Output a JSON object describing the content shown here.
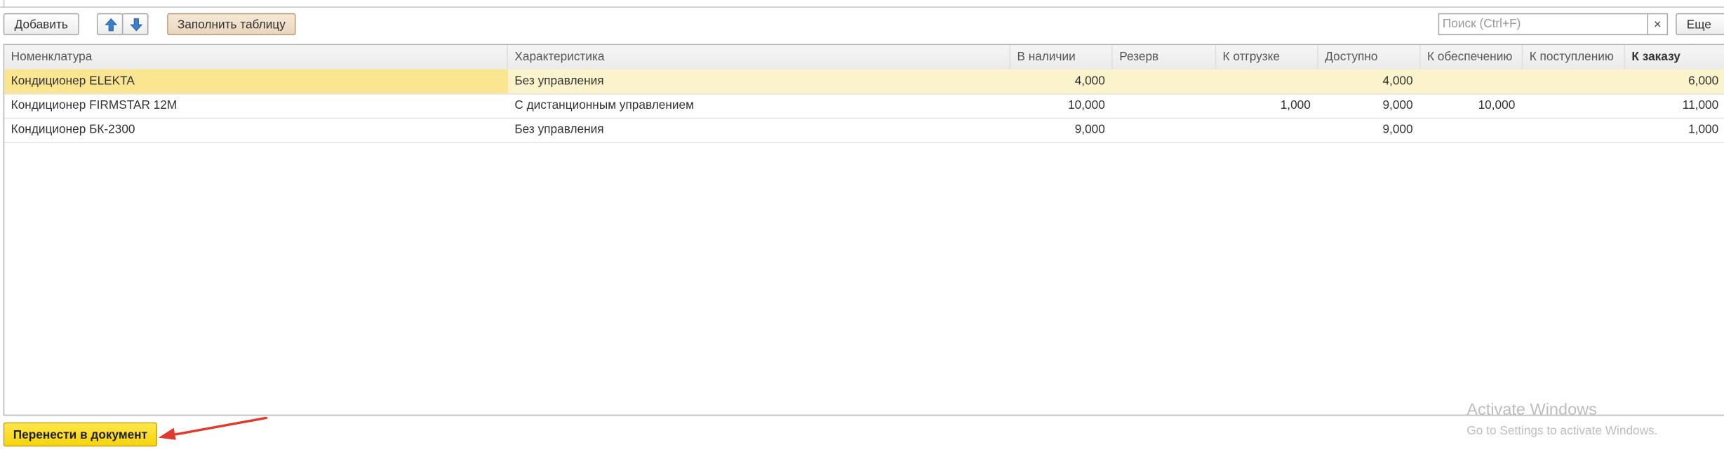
{
  "toolbar": {
    "add_label": "Добавить",
    "fill_label": "Заполнить таблицу",
    "more_label": "Еще",
    "up_icon": "arrow-up-icon",
    "down_icon": "arrow-down-icon"
  },
  "search": {
    "placeholder": "Поиск (Ctrl+F)",
    "value": "",
    "clear_label": "×"
  },
  "table": {
    "columns": [
      "Номенклатура",
      "Характеристика",
      "В наличии",
      "Резерв",
      "К отгрузке",
      "Доступно",
      "К обеспечению",
      "К поступлению",
      "К заказу"
    ],
    "rows": [
      {
        "item": "Кондиционер ELEKTA",
        "characteristic": "Без управления",
        "in_stock": "4,000",
        "reserve": "",
        "to_ship": "",
        "available": "4,000",
        "to_provide": "",
        "to_receive": "",
        "to_order": "6,000",
        "selected": true
      },
      {
        "item": "Кондиционер FIRMSTAR 12M",
        "characteristic": "С дистанционным управлением",
        "in_stock": "10,000",
        "reserve": "",
        "to_ship": "1,000",
        "available": "9,000",
        "to_provide": "10,000",
        "to_receive": "",
        "to_order": "11,000",
        "selected": false
      },
      {
        "item": "Кондиционер БК-2300",
        "characteristic": "Без управления",
        "in_stock": "9,000",
        "reserve": "",
        "to_ship": "",
        "available": "9,000",
        "to_provide": "",
        "to_receive": "",
        "to_order": "1,000",
        "selected": false
      }
    ]
  },
  "footer": {
    "transfer_label": "Перенести в документ"
  },
  "watermark": {
    "title": "Activate Windows",
    "subtitle": "Go to Settings to activate Windows."
  },
  "colors": {
    "selected_row": "#fbf3cc",
    "selected_cell": "#fae591",
    "primary_button": "#f6d40c",
    "annotation_arrow": "#e03a2f",
    "arrow_icon": "#3a7fd0"
  }
}
